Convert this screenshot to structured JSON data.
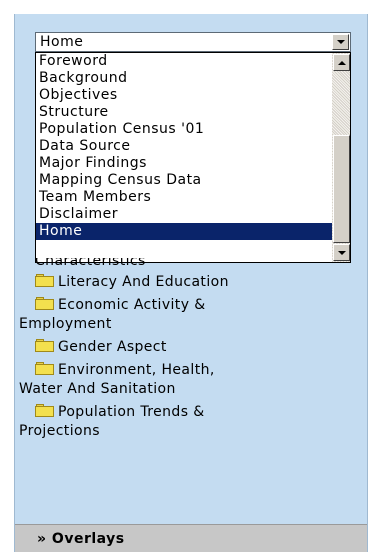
{
  "select": {
    "value": "Home",
    "options": [
      "Foreword",
      "Background",
      "Objectives",
      "Structure",
      "Population Census '01",
      "Data Source",
      "Major Findings",
      "Mapping Census Data",
      "Team Members",
      "Disclaimer",
      "Home"
    ],
    "selected_index": 10
  },
  "background": {
    "partial_label": "Characteristics",
    "raquo": "»"
  },
  "categories": [
    {
      "label": "Literacy And Education",
      "icon": "folder-icon"
    },
    {
      "label": "Economic Activity &",
      "label2": "Employment",
      "icon": "folder-icon"
    },
    {
      "label": "Gender Aspect",
      "icon": "folder-icon"
    },
    {
      "label": "Environment, Health,",
      "label2": "Water And Sanitation",
      "icon": "folder-icon"
    },
    {
      "label": "Population Trends &",
      "label2": "Projections",
      "icon": "folder-icon"
    }
  ],
  "footer": {
    "label": "» Overlays"
  },
  "colors": {
    "panel_bg": "#c4dcf1",
    "selected_bg": "#0a246a",
    "footer_bg": "#c7c7c7",
    "folder": "#f3e04e"
  }
}
